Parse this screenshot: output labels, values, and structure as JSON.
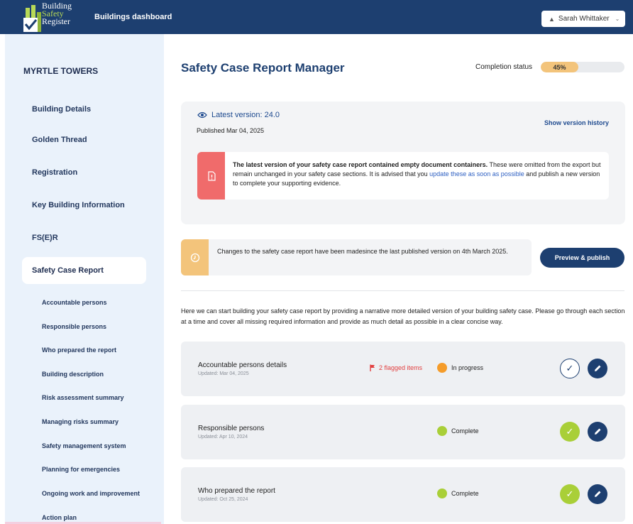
{
  "header": {
    "logo_lines": [
      "Building",
      "Safety",
      "Register"
    ],
    "app_title": "Buildings dashboard",
    "user_name": "Sarah Whittaker"
  },
  "sidebar": {
    "building_name": "MYRTLE TOWERS",
    "items": [
      {
        "label": "Building Details"
      },
      {
        "label": "Golden Thread"
      },
      {
        "label": "Registration"
      },
      {
        "label": "Key Building Information"
      },
      {
        "label": "FS(E)R"
      },
      {
        "label": "Safety Case Report",
        "active": true
      }
    ],
    "sub_items": [
      {
        "label": "Accountable persons"
      },
      {
        "label": "Responsible persons"
      },
      {
        "label": "Who prepared the report"
      },
      {
        "label": "Building description"
      },
      {
        "label": "Risk assessment summary"
      },
      {
        "label": "Managing risks summary"
      },
      {
        "label": "Safety management system"
      },
      {
        "label": "Planning for emergencies"
      },
      {
        "label": "Ongoing work and improvement"
      },
      {
        "label": "Action plan"
      }
    ]
  },
  "main": {
    "title": "Safety Case Report Manager",
    "completion_label": "Completion status",
    "completion_text": "45%",
    "completion_value": 0.45,
    "version": {
      "latest": "Latest version: 24.0",
      "published": "Published Mar 04, 2025",
      "history_link": "Show version history"
    },
    "alert": {
      "bold": "The latest version of your safety case report contained empty document containers.",
      "text1": " These were omitted from the export but remain unchanged in your safety case sections. It is advised that you ",
      "link": "update these as soon as possible",
      "text2": " and publish a new version to complete your supporting evidence."
    },
    "notice": {
      "text": "Changes to the safety case report have been madesince the last published version on 4th March 2025."
    },
    "preview_button": "Preview & publish",
    "intro": "Here we can start building your safety case report by providing a narrative more detailed version of your building safety case. Please go through each section at a time and cover all missing required information and provide as much detail as possible in a clear concise way.",
    "sections": [
      {
        "title": "Accountable persons details",
        "updated": "Updated: Mar 04, 2025",
        "flags": "2 flagged items",
        "status": "In progress",
        "status_color": "#f59c2a",
        "checked": false
      },
      {
        "title": "Responsible persons",
        "updated": "Updated: Apr 10, 2024",
        "flags": "",
        "status": "Complete",
        "status_color": "#a9cf38",
        "checked": true
      },
      {
        "title": "Who prepared the report",
        "updated": "Updated: Oct 25, 2024",
        "flags": "",
        "status": "Complete",
        "status_color": "#a9cf38",
        "checked": true
      }
    ]
  },
  "colors": {
    "brand": "#1d3f70",
    "alert": "#f06b6b",
    "warning": "#f3c47b",
    "complete": "#a9cf38",
    "in_progress": "#f59c2a",
    "flag": "#e24040"
  }
}
